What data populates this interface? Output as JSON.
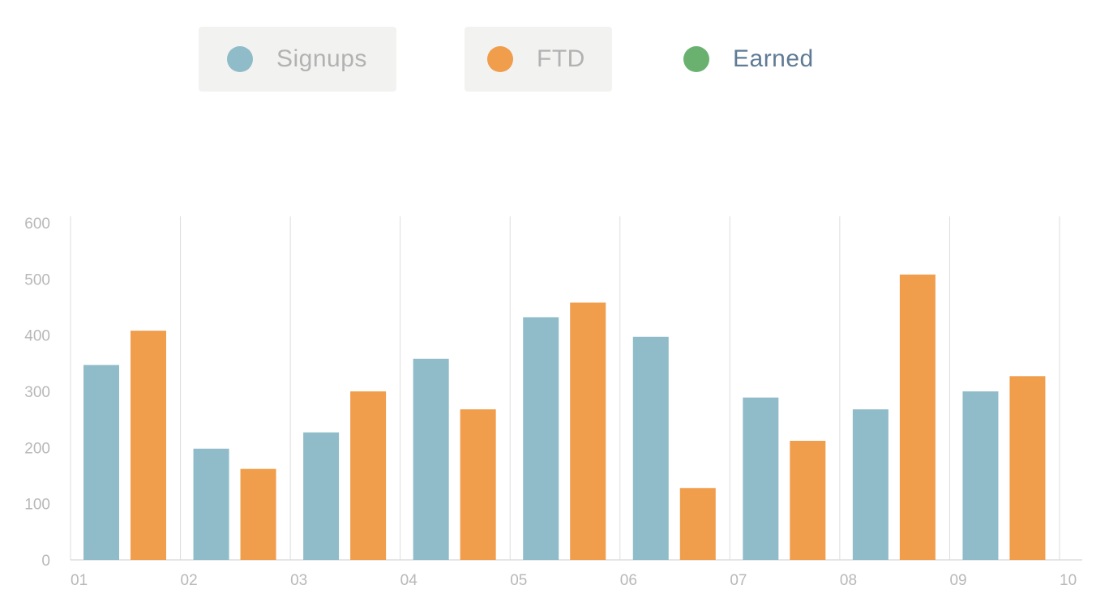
{
  "colors": {
    "signups": "#8fbcc8",
    "ftd": "#f09d4c",
    "earned": "#6ab170",
    "grid": "#dddddd",
    "tick_text": "#b8b8b8"
  },
  "legend": {
    "items": [
      {
        "label": "Signups",
        "color": "#8fbcc8",
        "active": false
      },
      {
        "label": "FTD",
        "color": "#f09d4c",
        "active": false
      },
      {
        "label": "Earned",
        "color": "#6ab170",
        "active": true
      }
    ]
  },
  "chart_data": {
    "type": "bar",
    "x_ticks": [
      "01",
      "02",
      "03",
      "04",
      "05",
      "06",
      "07",
      "08",
      "09",
      "10"
    ],
    "categories": [
      "01",
      "02",
      "03",
      "04",
      "05",
      "06",
      "07",
      "08",
      "09"
    ],
    "series": [
      {
        "name": "Signups",
        "color": "#8fbcc8",
        "values": [
          347,
          198,
          227,
          358,
          432,
          397,
          289,
          268,
          300
        ]
      },
      {
        "name": "FTD",
        "color": "#f09d4c",
        "values": [
          408,
          162,
          300,
          268,
          458,
          128,
          212,
          508,
          327
        ]
      }
    ],
    "ylim": [
      0,
      600
    ],
    "y_ticks": [
      "0",
      "100",
      "200",
      "300",
      "400",
      "500",
      "600"
    ],
    "xlabel": "",
    "ylabel": "",
    "title": "",
    "grid": "vertical",
    "legend_position": "top-center"
  }
}
